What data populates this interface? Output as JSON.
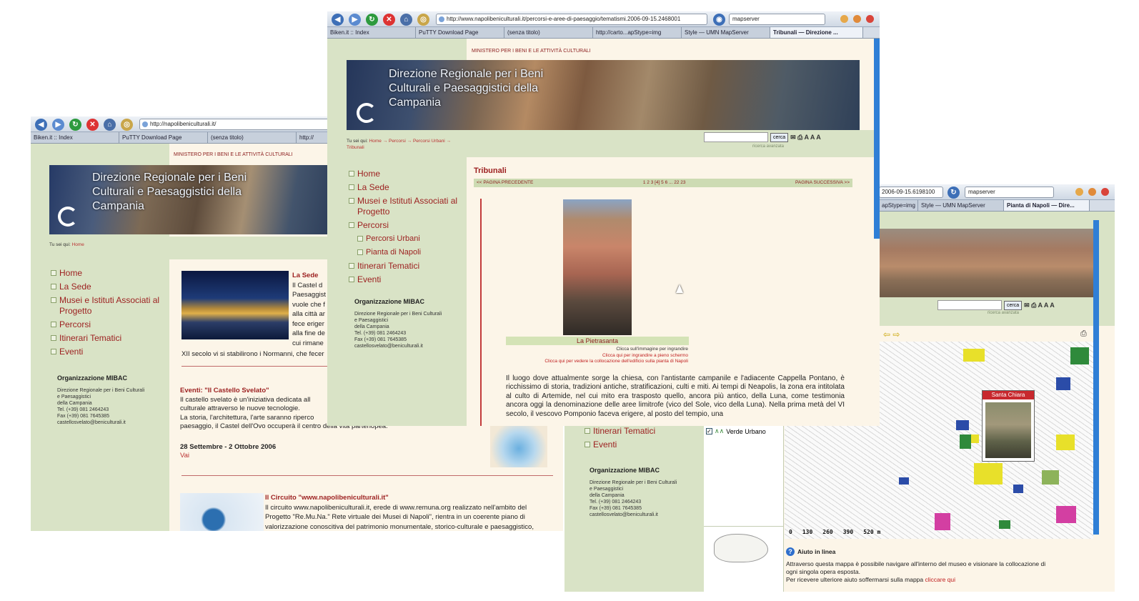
{
  "browser": {
    "tabs": [
      "Biken.it :: Index",
      "PuTTY Download Page",
      "(senza titolo)",
      "http://carto...apStype=img",
      "Style — UMN MapServer"
    ],
    "back_tabs": [
      "Biken.it :: Index",
      "PuTTY Download Page",
      "(senza titolo)",
      "http://"
    ]
  },
  "win_left": {
    "url": "http://napolibeniculturali.it/",
    "ministry": "MINISTERO PER I BENI E LE ATTIVITÀ CULTURALI",
    "banner_title": "Direzione Regionale per i Beni Culturali e Paesaggistici della Campania",
    "breadcrumb_prefix": "Tu sei qui:",
    "breadcrumb_home": "Home",
    "nav": [
      "Home",
      "La Sede",
      "Musei e Istituti Associati al Progetto",
      "Percorsi",
      "Itinerari Tematici",
      "Eventi"
    ],
    "org_title": "Organizzazione MIBAC",
    "org_lines": [
      "Direzione Regionale per i Beni Culturali",
      "e Paesaggistici",
      "della Campania",
      "Tel. (+39) 081 2464243",
      "Fax (+39) 081 7645385",
      "castellosvelato@beniculturali.it"
    ],
    "sede_title": "La Sede",
    "sede_lines": [
      "Il Castel d",
      "Paesaggist",
      "vuole che f",
      "alla città ar",
      "fece eriger",
      "alla fine de",
      "cui rimane"
    ],
    "sede_tail": "XII secolo vi si stabilirono i Normanni, che fecer",
    "event_title": "Eventi: \"Il Castello Svelato\"",
    "event_lines": [
      "Il castello svelato è un'iniziativa dedicata all",
      "culturale attraverso le nuove tecnologie.",
      "La storia, l'architettura, l'arte saranno riperco",
      "paesaggio, il Castel dell'Ovo occuperà il centro della vita partenopea."
    ],
    "event_dates": "28 Settembre - 2 Ottobre 2006",
    "vai": "Vai",
    "circuit_title": "Il Circuito \"www.napolibeniculturali.it\"",
    "circuit_lines": [
      "Il circuito www.napolibeniculturali.it, erede di www.remuna.org realizzato nell'ambito del",
      "Progetto \"Re.Mu.Na.\" Rete virtuale dei Musei di Napoli\", rientra in un coerente piano di",
      "valorizzazione conoscitiva del patrimonio monumentale, storico-culturale e paesaggistico,"
    ]
  },
  "win_center": {
    "url": "http://www.napolibeniculturali.it/percorsi-e-aree-di-paesaggio/tematismi.2006-09-15.2468001",
    "search_engine": "mapserver",
    "active_tab": "Tribunali — Direzione ...",
    "ministry": "MINISTERO PER I BENI E LE ATTIVITÀ CULTURALI",
    "banner_title": "Direzione Regionale per i Beni Culturali e Paesaggistici della Campania",
    "breadcrumb_prefix": "Tu sei qui:",
    "breadcrumb_path": "Home → Percorsi → Percorsi Urbani → Tribunali",
    "search_button": "cerca",
    "advanced_search": "ricerca avanzata",
    "nav": [
      "Home",
      "La Sede",
      "Musei e Istituti Associati al Progetto",
      "Percorsi"
    ],
    "subnav": [
      "Percorsi Urbani",
      "Pianta di Napoli"
    ],
    "nav2": [
      "Itinerari Tematici",
      "Eventi"
    ],
    "org_title": "Organizzazione MIBAC",
    "org_lines": [
      "Direzione Regionale per i Beni Culturali",
      "e Paesaggistici",
      "della Campania",
      "Tel. (+39) 081 2464243",
      "Fax (+39) 081 7645385",
      "castellosvelato@beniculturali.it"
    ],
    "page_title": "Tribunali",
    "prev": "<< PAGINA PRECEDENTE",
    "pages": "1 2 3 [4] 5 6 ... 22 23",
    "next": "PAGINA SUCCESSIVA >>",
    "caption": "La Pietrasanta",
    "click1": "Clicca sull'immagine per ingrandire",
    "click2": "Clicca qui per ingrandire a pieno schermo",
    "click3": "Clicca qui per vedere la collocazione dell'edificio sulla pianta di Napoli",
    "body": "Il luogo dove attualmente sorge la chiesa, con l'antistante campanile e l'adiacente Cappella Pontano, è ricchissimo di storia, tradizioni antiche, stratificazioni, culti e miti. Ai tempi di Neapolis, la zona era intitolata al culto di Artemide, nel cui mito era trasposto quello, ancora più antico, della Luna, come testimonia ancora oggi la denominazione delle aree limitrofe (vico del Sole, vico della Luna). Nella prima metà del VI secolo, il vescovo Pomponio faceva erigere, al posto del tempio, una"
  },
  "win_right": {
    "url": "2006-09-15.6198100",
    "search_engine": "mapserver",
    "tabs": [
      "apStype=img",
      "Style — UMN MapServer"
    ],
    "active_tab": "Pianta di Napoli — Dire...",
    "search_button": "cerca",
    "advanced_search": "ricerca avanzata",
    "nav": [
      "Itinerari Tematici",
      "Eventi"
    ],
    "layer_label": "Verde Urbano",
    "org_title": "Organizzazione MIBAC",
    "org_lines": [
      "Direzione Regionale per i Beni Culturali",
      "e Paesaggistici",
      "della Campania",
      "Tel. (+39) 081 2464243",
      "Fax (+39) 081 7645385",
      "castellosvelato@beniculturali.it"
    ],
    "popup_label": "Santa Chiara",
    "scale": [
      "0",
      "130",
      "260",
      "390",
      "520 m"
    ],
    "help_title": "Aiuto in linea",
    "help_lines": [
      "Attraverso questa mappa è possibile navigare all'interno del museo e visionare la collocazione di",
      "ogni singola opera esposta."
    ],
    "help_more": "Per ricevere ulteriore aiuto soffermarsi sulla mappa",
    "help_link": "cliccare qui"
  }
}
